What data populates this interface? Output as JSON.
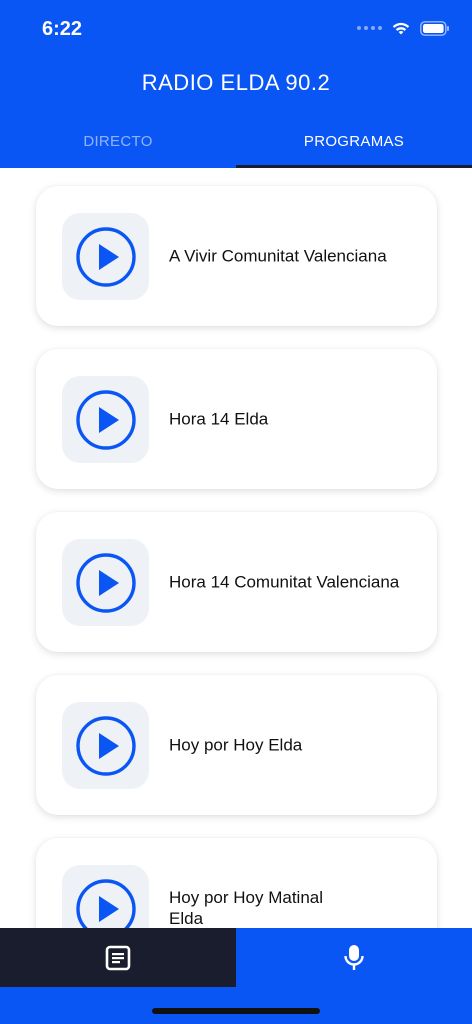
{
  "status_bar": {
    "time": "6:22",
    "wifi_icon": "wifi-icon",
    "battery_icon": "battery-icon"
  },
  "header": {
    "title": "RADIO ELDA 90.2"
  },
  "tabs": [
    {
      "label": "DIRECTO",
      "active": false
    },
    {
      "label": "PROGRAMAS",
      "active": true
    }
  ],
  "programs": [
    {
      "title": "A Vivir Comunitat Valenciana",
      "icon": "play-icon"
    },
    {
      "title": "Hora 14 Elda",
      "icon": "play-icon"
    },
    {
      "title": "Hora 14 Comunitat Valenciana",
      "icon": "play-icon"
    },
    {
      "title": "Hoy por Hoy Elda",
      "icon": "play-icon"
    },
    {
      "title": "Hoy por Hoy Matinal Elda",
      "icon": "play-icon"
    }
  ],
  "bottom_nav": {
    "left_icon": "news-icon",
    "right_icon": "microphone-icon"
  },
  "colors": {
    "brand": "#0a56f5",
    "dark": "#1a1d2e",
    "card_thumb": "#eef1f6"
  }
}
